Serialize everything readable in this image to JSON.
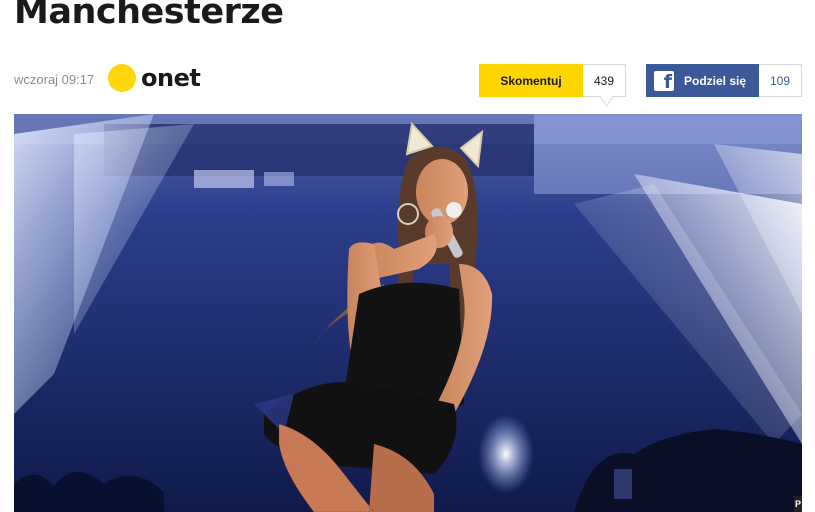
{
  "article": {
    "headline": "Manchesterze",
    "timestamp": "wczoraj 09:17",
    "source": "onet"
  },
  "actions": {
    "comment_label": "Skomentuj",
    "comment_count": "439",
    "share_label": "Podziel się",
    "share_count": "109",
    "facebook_icon_letter": "f"
  },
  "photo": {
    "credit_letter": "P"
  },
  "colors": {
    "onet_yellow": "#ffd60a",
    "comment_yellow": "#ffd600",
    "facebook_blue": "#3b5998",
    "headline": "#1a1a1a",
    "meta_gray": "#8c8c8c"
  },
  "icons": [
    "onet-logo-dot",
    "facebook-icon"
  ]
}
